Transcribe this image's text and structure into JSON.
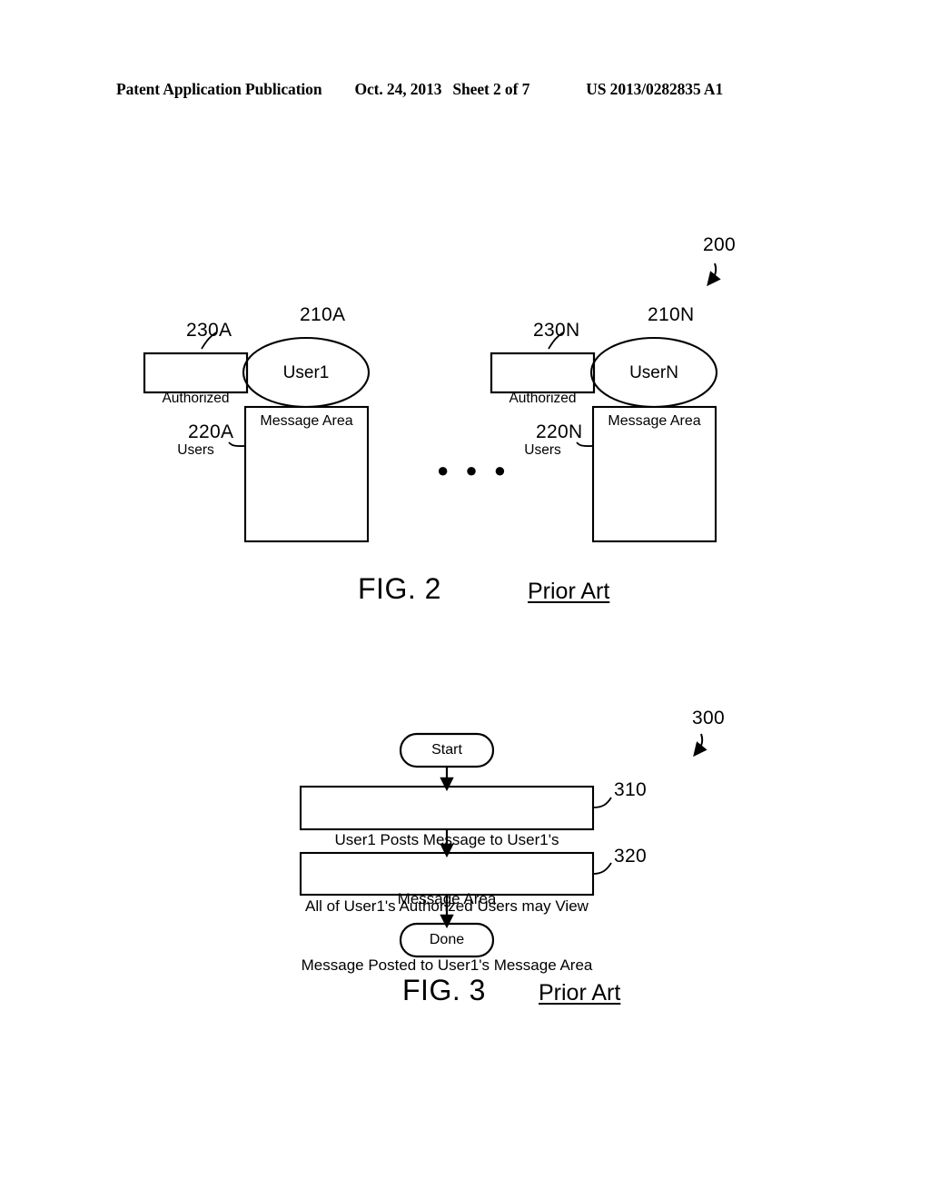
{
  "header": {
    "publication": "Patent Application Publication",
    "date": "Oct. 24, 2013",
    "sheet": "Sheet 2 of 7",
    "publication_number": "US 2013/0282835 A1"
  },
  "colors": {
    "ink": "#000000",
    "paper": "#ffffff"
  },
  "figure2": {
    "caption": "FIG. 2",
    "prior_art": "Prior Art",
    "system_ref": "200",
    "ellipsis": "● ● ●",
    "groups": [
      {
        "user_ref": "210A",
        "user_label": "User1",
        "authorized_ref": "230A",
        "authorized_line1": "Authorized",
        "authorized_line2": "Users",
        "message_ref": "220A",
        "message_label": "Message Area"
      },
      {
        "user_ref": "210N",
        "user_label": "UserN",
        "authorized_ref": "230N",
        "authorized_line1": "Authorized",
        "authorized_line2": "Users",
        "message_ref": "220N",
        "message_label": "Message Area"
      }
    ]
  },
  "figure3": {
    "caption": "FIG. 3",
    "prior_art": "Prior Art",
    "flow_ref": "300",
    "start_label": "Start",
    "done_label": "Done",
    "steps": [
      {
        "ref": "310",
        "line1": "User1 Posts Message to User1's",
        "line2": "Message Area"
      },
      {
        "ref": "320",
        "line1": "All of User1's Authorized Users may View",
        "line2": "Message Posted to User1's Message Area"
      }
    ]
  }
}
